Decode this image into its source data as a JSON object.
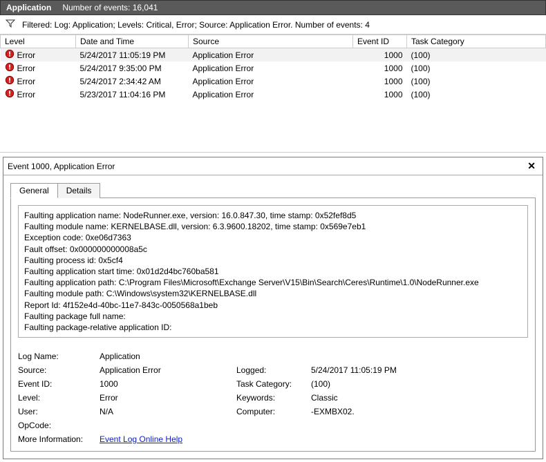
{
  "header": {
    "title": "Application",
    "events_label": "Number of events: 16,041"
  },
  "filter": {
    "text": "Filtered: Log: Application; Levels: Critical, Error; Source: Application Error. Number of events: 4"
  },
  "table": {
    "columns": {
      "level": "Level",
      "datetime": "Date and Time",
      "source": "Source",
      "event_id": "Event ID",
      "task_category": "Task Category"
    },
    "rows": [
      {
        "level": "Error",
        "datetime": "5/24/2017 11:05:19 PM",
        "source": "Application Error",
        "event_id": "1000",
        "task_category": "(100)",
        "selected": true
      },
      {
        "level": "Error",
        "datetime": "5/24/2017 9:35:00 PM",
        "source": "Application Error",
        "event_id": "1000",
        "task_category": "(100)",
        "selected": false
      },
      {
        "level": "Error",
        "datetime": "5/24/2017 2:34:42 AM",
        "source": "Application Error",
        "event_id": "1000",
        "task_category": "(100)",
        "selected": false
      },
      {
        "level": "Error",
        "datetime": "5/23/2017 11:04:16 PM",
        "source": "Application Error",
        "event_id": "1000",
        "task_category": "(100)",
        "selected": false
      }
    ]
  },
  "detail": {
    "title": "Event 1000, Application Error",
    "tabs": {
      "general": "General",
      "details": "Details"
    },
    "fault_text": "Faulting application name: NodeRunner.exe, version: 16.0.847.30, time stamp: 0x52fef8d5\nFaulting module name: KERNELBASE.dll, version: 6.3.9600.18202, time stamp: 0x569e7eb1\nException code: 0xe06d7363\nFault offset: 0x000000000008a5c\nFaulting process id: 0x5cf4\nFaulting application start time: 0x01d2d4bc760ba581\nFaulting application path: C:\\Program Files\\Microsoft\\Exchange Server\\V15\\Bin\\Search\\Ceres\\Runtime\\1.0\\NodeRunner.exe\nFaulting module path: C:\\Windows\\system32\\KERNELBASE.dll\nReport Id: 4f152e4d-40bc-11e7-843c-0050568a1beb\nFaulting package full name:\nFaulting package-relative application ID:",
    "labels": {
      "log_name": "Log Name:",
      "source": "Source:",
      "event_id": "Event ID:",
      "level": "Level:",
      "user": "User:",
      "opcode": "OpCode:",
      "more_info": "More Information:",
      "logged": "Logged:",
      "task_category": "Task Category:",
      "keywords": "Keywords:",
      "computer": "Computer:"
    },
    "values": {
      "log_name": "Application",
      "source": "Application Error",
      "event_id": "1000",
      "level": "Error",
      "user": "N/A",
      "opcode": "",
      "more_info_link": "Event Log Online Help",
      "logged": "5/24/2017 11:05:19 PM",
      "task_category": "(100)",
      "keywords": "Classic",
      "computer": "-EXMBX02."
    }
  }
}
